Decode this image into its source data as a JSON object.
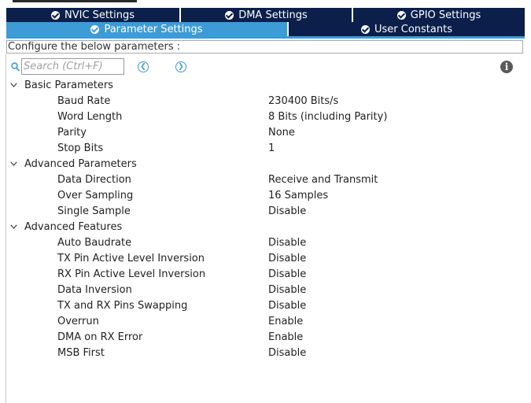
{
  "tabs_row1": [
    {
      "label": "NVIC Settings"
    },
    {
      "label": "DMA Settings"
    },
    {
      "label": "GPIO Settings"
    }
  ],
  "tabs_row2": [
    {
      "label": "Parameter Settings",
      "active": true
    },
    {
      "label": "User Constants",
      "active": false
    }
  ],
  "config_label": "Configure the below parameters :",
  "search": {
    "placeholder": "Search (Ctrl+F)"
  },
  "groups": [
    {
      "label": "Basic Parameters",
      "params": [
        {
          "name": "Baud Rate",
          "value": "230400 Bits/s"
        },
        {
          "name": "Word Length",
          "value": "8 Bits (including Parity)"
        },
        {
          "name": "Parity",
          "value": "None"
        },
        {
          "name": "Stop Bits",
          "value": "1"
        }
      ]
    },
    {
      "label": "Advanced Parameters",
      "params": [
        {
          "name": "Data Direction",
          "value": "Receive and Transmit"
        },
        {
          "name": "Over Sampling",
          "value": "16 Samples"
        },
        {
          "name": "Single Sample",
          "value": "Disable"
        }
      ]
    },
    {
      "label": "Advanced Features",
      "params": [
        {
          "name": "Auto Baudrate",
          "value": "Disable"
        },
        {
          "name": "TX Pin Active Level Inversion",
          "value": "Disable"
        },
        {
          "name": "RX Pin Active Level Inversion",
          "value": "Disable"
        },
        {
          "name": "Data Inversion",
          "value": "Disable"
        },
        {
          "name": "TX and RX Pins Swapping",
          "value": "Disable"
        },
        {
          "name": "Overrun",
          "value": "Enable"
        },
        {
          "name": "DMA on RX Error",
          "value": "Enable"
        },
        {
          "name": "MSB First",
          "value": "Disable"
        }
      ]
    }
  ],
  "colors": {
    "tab_dark": "#0b1f4a",
    "tab_active": "#3d9bd6",
    "check_green": "#1a7a1a",
    "accent_blue": "#3d9bd6"
  },
  "icons": {
    "search": "search-icon",
    "prev": "chevron-left-circle-icon",
    "next": "chevron-right-circle-icon",
    "info": "info-icon",
    "expand": "chevron-down-icon",
    "tab_status": "check-circle-icon"
  }
}
